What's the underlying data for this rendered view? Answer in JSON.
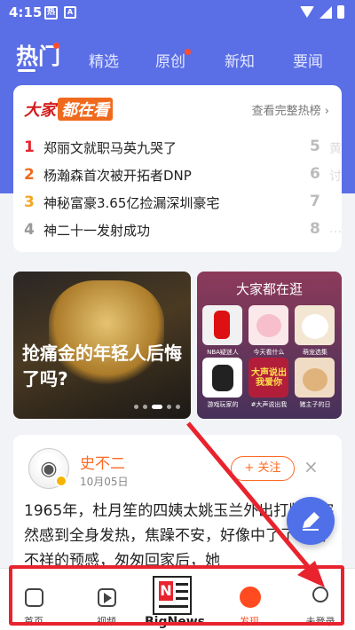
{
  "status": {
    "time": "4:15",
    "icon1": "热",
    "icon2": "A"
  },
  "tabs": [
    {
      "label": "热门",
      "active": true
    },
    {
      "label": "精选"
    },
    {
      "label": "原创"
    },
    {
      "label": "新知"
    },
    {
      "label": "要闻"
    }
  ],
  "hot": {
    "logo_a": "大家",
    "logo_b": "都在看",
    "more": "查看完整热榜 ›",
    "items": [
      {
        "num": "1",
        "title": "郑丽文就职马英九哭了",
        "color": "#e8232e"
      },
      {
        "num": "2",
        "title": "杨瀚森首次被开拓者DNP",
        "color": "#f06a1e"
      },
      {
        "num": "3",
        "title": "神秘富豪3.65亿捡漏深圳豪宅",
        "color": "#f5a623"
      },
      {
        "num": "4",
        "title": "神二十一发射成功",
        "color": "#999999"
      }
    ],
    "side_nums": [
      "5",
      "6",
      "7",
      "8"
    ],
    "side_text": [
      "黄",
      "讨",
      "",
      "…"
    ]
  },
  "feature1": {
    "title": "抢痛金的年轻人后悔了吗?"
  },
  "feature2": {
    "title": "大家都在逛",
    "items": [
      {
        "label": "NBA疑迷人"
      },
      {
        "label": "今天看什么"
      },
      {
        "label": "萌宠选集"
      },
      {
        "label": "游戏玩家的"
      },
      {
        "label": "#大声说出我"
      },
      {
        "label": "猪主子的日"
      }
    ],
    "sticker": "大声说出 我爱你"
  },
  "article": {
    "author": "史不二",
    "date": "10月05日",
    "follow": "+ 关注",
    "close": "×",
    "text": "1965年，杜月笙的四姨太姚玉兰外出打牌，突然感到全身发热，焦躁不安，好像中了了一股不祥的预感，匆匆回家后，她"
  },
  "nav": [
    {
      "label": "首页",
      "icon": "home-icon"
    },
    {
      "label": "视频",
      "icon": "video-icon"
    },
    {
      "label": "BigNews",
      "icon": "bignews-logo-icon"
    },
    {
      "label": "发现",
      "icon": "planet-icon",
      "active": true
    },
    {
      "label": "未登录",
      "icon": "user-icon"
    }
  ]
}
